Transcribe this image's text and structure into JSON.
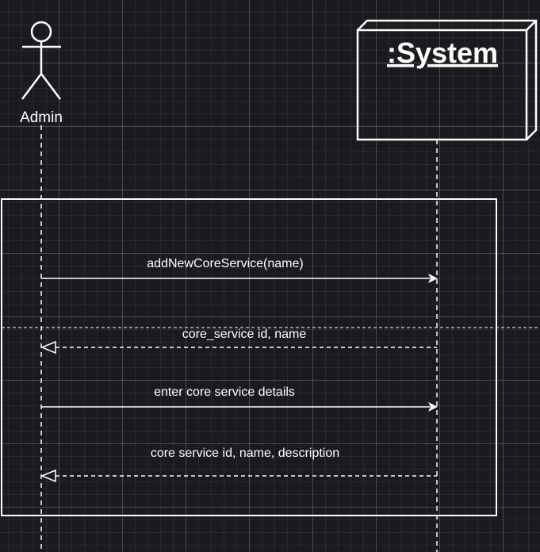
{
  "actor": {
    "name": "Admin"
  },
  "system": {
    "title": ":System"
  },
  "messages": [
    {
      "label": "addNewCoreService(name)",
      "kind": "sync"
    },
    {
      "label": "core_service id, name",
      "kind": "return"
    },
    {
      "label": "enter core service details",
      "kind": "sync"
    },
    {
      "label": "core service id, name, description",
      "kind": "return"
    }
  ],
  "colors": {
    "background": "#1d1a1f",
    "stroke": "#ffffff"
  }
}
